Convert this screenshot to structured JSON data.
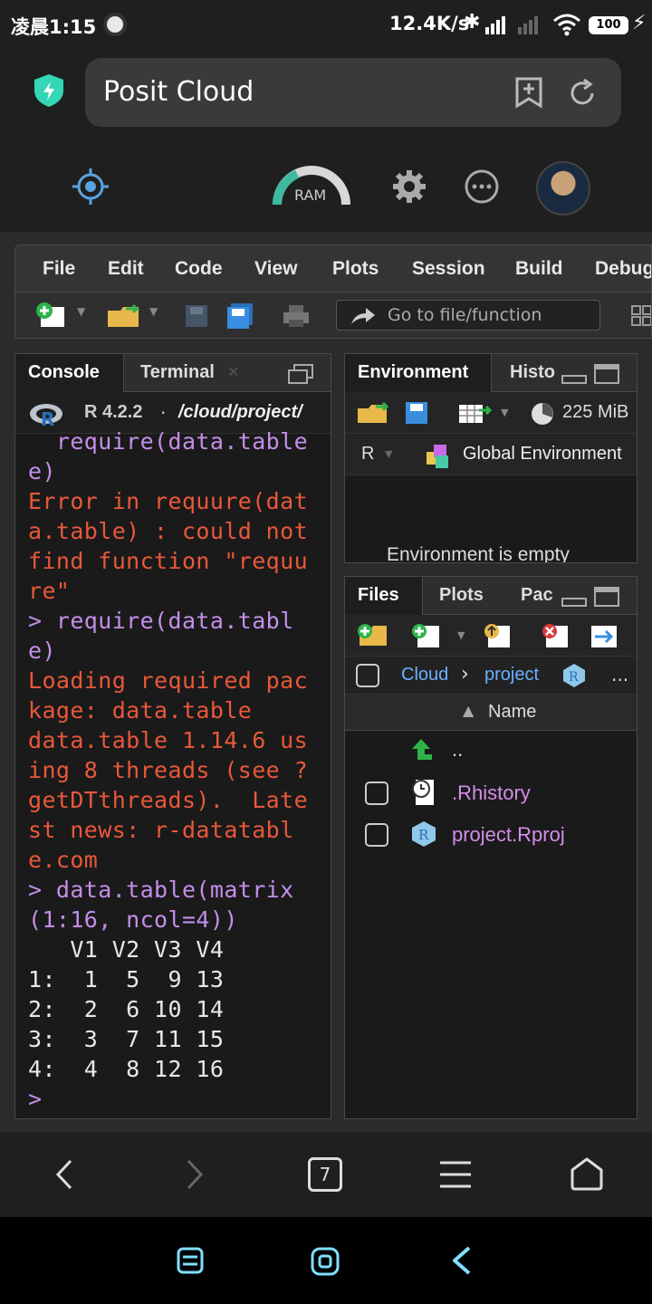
{
  "status_bar": {
    "time": "凌晨1:15",
    "network_speed": "12.4K/s",
    "battery": "100"
  },
  "browser": {
    "page_title": "Posit Cloud",
    "ram_label": "RAM"
  },
  "menu": {
    "items": [
      "File",
      "Edit",
      "Code",
      "View",
      "Plots",
      "Session",
      "Build",
      "Debug"
    ]
  },
  "toolbar": {
    "goto_placeholder": "Go to file/function"
  },
  "console_pane": {
    "tabs": [
      "Console",
      "Terminal"
    ],
    "r_version": "R 4.2.2",
    "path": "/cloud/project/",
    "lines": [
      {
        "type": "prompt",
        "text": "  require(data.table"
      },
      {
        "type": "prompt",
        "text": "e)"
      },
      {
        "type": "err",
        "text": "Error in requure(dat"
      },
      {
        "type": "err",
        "text": "a.table) : could not"
      },
      {
        "type": "err",
        "text": "find function \"requu"
      },
      {
        "type": "err",
        "text": "re\""
      },
      {
        "type": "prompt",
        "text": "> require(data.tabl"
      },
      {
        "type": "prompt",
        "text": "e)"
      },
      {
        "type": "load",
        "text": "Loading required pac"
      },
      {
        "type": "load",
        "text": "kage: data.table"
      },
      {
        "type": "load",
        "text": "data.table 1.14.6 us"
      },
      {
        "type": "load",
        "text": "ing 8 threads (see ?"
      },
      {
        "type": "load",
        "text": "getDTthreads).  Late"
      },
      {
        "type": "load",
        "text": "st news: r-datatabl"
      },
      {
        "type": "load",
        "text": "e.com"
      },
      {
        "type": "prompt",
        "text": "> data.table(matrix"
      },
      {
        "type": "prompt",
        "text": "(1:16, ncol=4))"
      },
      {
        "type": "out",
        "text": "   V1 V2 V3 V4"
      },
      {
        "type": "out",
        "text": "1:  1  5  9 13"
      },
      {
        "type": "out",
        "text": "2:  2  6 10 14"
      },
      {
        "type": "out",
        "text": "3:  3  7 11 15"
      },
      {
        "type": "out",
        "text": "4:  4  8 12 16"
      },
      {
        "type": "prompt",
        "text": ">"
      }
    ]
  },
  "env_pane": {
    "tabs": [
      "Environment",
      "Histo"
    ],
    "memory": "225 MiB",
    "language": "R",
    "scope": "Global Environment",
    "empty_message": "Environment is empty"
  },
  "files_pane": {
    "tabs": [
      "Files",
      "Plots",
      "Pac"
    ],
    "breadcrumb": [
      "Cloud",
      "project"
    ],
    "more": "...",
    "column_name": "Name",
    "items": [
      {
        "name": "..",
        "icon": "up-arrow-icon"
      },
      {
        "name": ".Rhistory",
        "icon": "history-file-icon"
      },
      {
        "name": "project.Rproj",
        "icon": "rproj-icon"
      }
    ]
  },
  "nav": {
    "tab_count": "7"
  },
  "colors": {
    "accent_error": "#e8583a",
    "prompt": "#c48ee8",
    "shield": "#33d6b5",
    "link": "#6ab0ff"
  }
}
